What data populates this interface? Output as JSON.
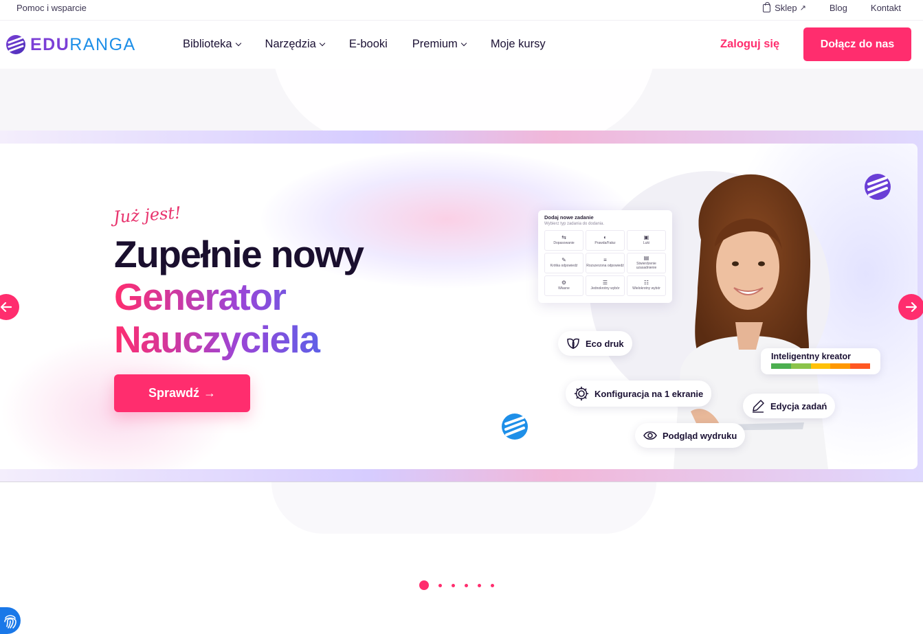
{
  "topbar": {
    "help": "Pomoc i wsparcie",
    "shop": "Sklep",
    "shop_arrow": "↗",
    "blog": "Blog",
    "contact": "Kontakt"
  },
  "nav": {
    "logo_part1": "EDU",
    "logo_part2": "RANGA",
    "items": [
      {
        "label": "Biblioteka"
      },
      {
        "label": "Narzędzia"
      },
      {
        "label": "E-booki"
      },
      {
        "label": "Premium"
      },
      {
        "label": "Moje kursy"
      }
    ],
    "login": "Zaloguj się",
    "join": "Dołącz do nas"
  },
  "hero": {
    "kicker": "Już jest!",
    "title_line1": "Zupełnie nowy",
    "title_line2": "Generator",
    "title_line3": "Nauczyciela",
    "cta": "Sprawdź",
    "cta_arrow": "→"
  },
  "panel": {
    "title": "Dodaj nowe zadanie",
    "subtitle": "Wybierz typ zadania do dodania.",
    "cells": [
      {
        "icon": "⇆",
        "label": "Dopasowanie"
      },
      {
        "icon": "◐",
        "label": "Prawda/Fałsz"
      },
      {
        "icon": "▣",
        "label": "Luki"
      },
      {
        "icon": "✎",
        "label": "Krótka odpowiedź"
      },
      {
        "icon": "≡",
        "label": "Rozszerzona odpowiedź"
      },
      {
        "icon": "▤",
        "label": "Stwierdzenie uzasadnienie"
      },
      {
        "icon": "⚙",
        "label": "Własne"
      },
      {
        "icon": "☰",
        "label": "Jednokrotny wybór"
      },
      {
        "icon": "☷",
        "label": "Wielokrotny wybór"
      }
    ]
  },
  "chips": {
    "eco": "Eco druk",
    "config": "Konfiguracja na 1 ekranie",
    "edit": "Edycja zadań",
    "preview": "Podgląd wydruku",
    "kreator": "Inteligentny kreator"
  },
  "colors": {
    "accent": "#ff2d6e",
    "logo_purple": "#7b3fd6",
    "logo_blue": "#1e8fe8",
    "bar": [
      "#4caf50",
      "#8bc34a",
      "#ffc107",
      "#ff9800",
      "#ff5722"
    ]
  },
  "carousel": {
    "slides": 6,
    "active": 1
  }
}
